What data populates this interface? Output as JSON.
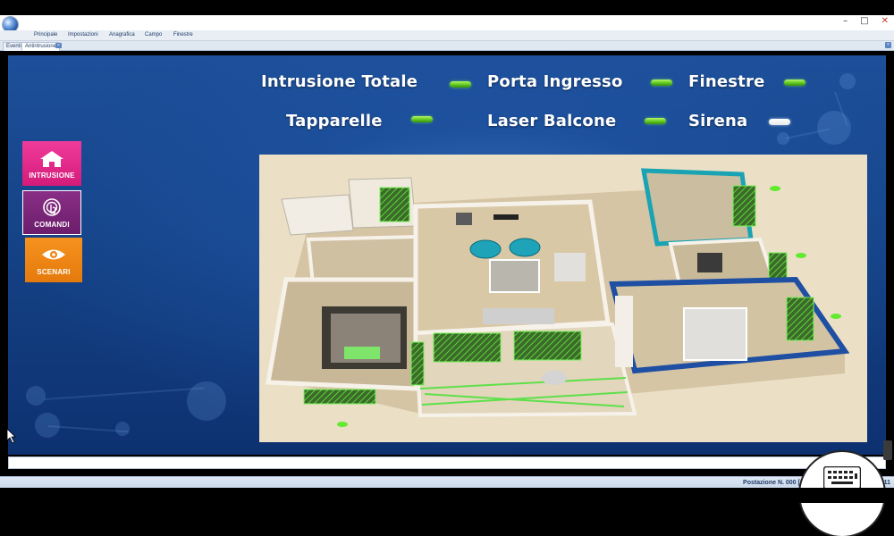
{
  "window": {
    "controls": {
      "minimize": "–",
      "maximize": "□",
      "close": "✕"
    }
  },
  "menu": {
    "items": [
      "Principale",
      "Impostazioni",
      "Anagrafica",
      "Campo",
      "Finestre"
    ]
  },
  "tabs": [
    {
      "label": "Eventi",
      "active": false
    },
    {
      "label": "Antintrusione",
      "active": true
    }
  ],
  "zones": [
    {
      "label": "Intrusione Totale",
      "state": "green"
    },
    {
      "label": "Porta Ingresso",
      "state": "green"
    },
    {
      "label": "Finestre",
      "state": "green"
    },
    {
      "label": "Tapparelle",
      "state": "green"
    },
    {
      "label": "Laser Balcone",
      "state": "green"
    },
    {
      "label": "Sirena",
      "state": "white"
    }
  ],
  "sidebar": {
    "intrusione_label": "INTRUSIONE",
    "comandi_label": "COMANDI",
    "scenari_label": "SCENARI"
  },
  "colors": {
    "intrusione": "#e0288a",
    "comandi": "#7a2478",
    "scenari": "#ee8614",
    "led_green": "#5fc91f",
    "led_white": "#ffffff",
    "panel_blue": "#154387"
  },
  "status": {
    "text": "Postazione N. 000 [!Postazione Zero d",
    "time_suffix": "19:28:11"
  },
  "icons": {
    "home": "home-icon",
    "comandi": "touch-icon",
    "scenari": "eye-icon",
    "keyboard": "keyboard-icon"
  }
}
